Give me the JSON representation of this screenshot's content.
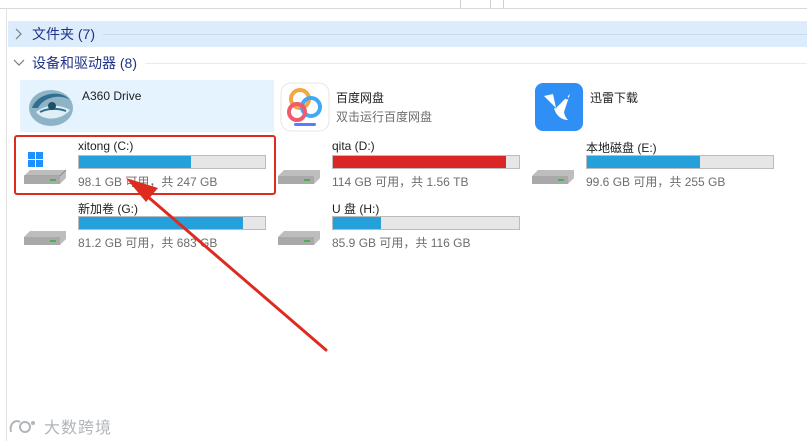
{
  "folders": {
    "title": "文件夹 (7)"
  },
  "devices": {
    "title": "设备和驱动器 (8)",
    "apps": [
      {
        "name": "A360 Drive",
        "subtitle": "",
        "icon": "a360-drive-icon"
      },
      {
        "name": "百度网盘",
        "subtitle": "双击运行百度网盘",
        "icon": "baidu-netdisk-icon"
      },
      {
        "name": "迅雷下载",
        "subtitle": "",
        "icon": "xunlei-bird-icon"
      }
    ],
    "drives": [
      {
        "name": "xitong (C:)",
        "info": "98.1 GB 可用，共 247 GB",
        "used_fraction": 0.6
      },
      {
        "name": "qita (D:)",
        "info": "114 GB 可用，共 1.56 TB",
        "used_fraction": 0.93
      },
      {
        "name": "本地磁盘 (E:)",
        "info": "99.6 GB 可用，共 255 GB",
        "used_fraction": 0.61
      },
      {
        "name": "新加卷 (G:)",
        "info": "81.2 GB 可用，共 683 GB",
        "used_fraction": 0.88
      },
      {
        "name": "U 盘 (H:)",
        "info": "85.9 GB 可用，共 116 GB",
        "used_fraction": 0.26
      }
    ]
  },
  "colors": {
    "bar_normal": "#26a0da",
    "bar_full": "#da2626",
    "annotation": "#dd2b20"
  },
  "watermark": {
    "text": "大数跨境"
  }
}
